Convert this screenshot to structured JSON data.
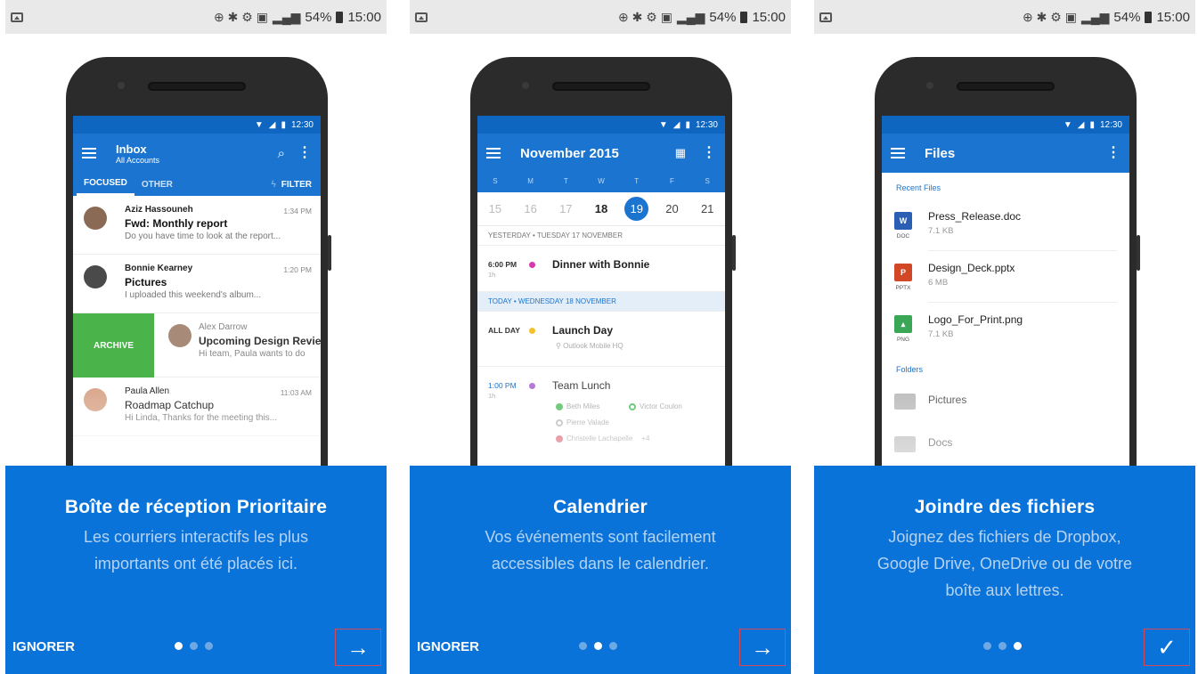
{
  "status_bar": {
    "battery": "54%",
    "time": "15:00",
    "net": "4G"
  },
  "inbox": {
    "phone_time": "12:30",
    "title": "Inbox",
    "subtitle": "All Accounts",
    "tab_focused": "FOCUSED",
    "tab_other": "OTHER",
    "filter": "FILTER",
    "mails": [
      {
        "name": "Aziz Hassouneh",
        "time": "1:34 PM",
        "subject": "Fwd: Monthly report",
        "preview": "Do you have time to look at the report..."
      },
      {
        "name": "Bonnie Kearney",
        "time": "1:20 PM",
        "subject": "Pictures",
        "preview": "I uploaded this weekend's album..."
      }
    ],
    "archive": "ARCHIVE",
    "swiped": {
      "name": "Alex Darrow",
      "subject": "Upcoming Design Revie",
      "preview": "Hi team, Paula wants to do"
    },
    "last": {
      "name": "Paula Allen",
      "time": "11:03 AM",
      "subject": "Roadmap Catchup",
      "preview": "Hi Linda, Thanks for the meeting this..."
    }
  },
  "calendar": {
    "phone_time": "12:30",
    "title": "November 2015",
    "weekdays": [
      "S",
      "M",
      "T",
      "W",
      "T",
      "F",
      "S"
    ],
    "days": [
      "15",
      "16",
      "17",
      "18",
      "19",
      "20",
      "21"
    ],
    "yesterday_header": "YESTERDAY • TUESDAY 17 NOVEMBER",
    "today_header": "TODAY • WEDNESDAY 18 NOVEMBER",
    "events": [
      {
        "time": "6:00 PM",
        "dur": "1h",
        "title": "Dinner with Bonnie",
        "color": "#d63aa9"
      },
      {
        "time": "ALL DAY",
        "dur": "",
        "title": "Launch Day",
        "location": "Outlook Mobile HQ",
        "color": "#f2c12e"
      },
      {
        "time": "1:00 PM",
        "dur": "1h",
        "title": "Team Lunch",
        "color": "#b47ad4"
      }
    ],
    "attendees": [
      "Beth Miles",
      "Victor Coulon",
      "Pierre Valade",
      "Christelle Lachapelle",
      "+4"
    ]
  },
  "files": {
    "phone_time": "12:30",
    "title": "Files",
    "recent_label": "Recent Files",
    "items": [
      {
        "name": "Press_Release.doc",
        "size": "7.1 KB",
        "type": "DOC",
        "icon": "word-icon",
        "color": "#2b5fb4"
      },
      {
        "name": "Design_Deck.pptx",
        "size": "6 MB",
        "type": "PPTX",
        "icon": "powerpoint-icon",
        "color": "#d24726"
      },
      {
        "name": "Logo_For_Print.png",
        "size": "7.1 KB",
        "type": "PNG",
        "icon": "image-icon",
        "color": "#3aa757"
      }
    ],
    "folders_label": "Folders",
    "folders": [
      "Pictures",
      "Docs"
    ]
  },
  "onboarding": [
    {
      "title": "Boîte de réception Prioritaire",
      "lines": [
        "Les courriers interactifs les plus",
        "importants ont été placés ici."
      ],
      "skip": "IGNORER",
      "next": "→"
    },
    {
      "title": "Calendrier",
      "lines": [
        "Vos événements sont facilement",
        "accessibles dans le calendrier."
      ],
      "skip": "IGNORER",
      "next": "→"
    },
    {
      "title": "Joindre des fichiers",
      "lines": [
        "Joignez des fichiers de Dropbox,",
        "Google Drive, OneDrive ou de votre",
        "boîte aux lettres."
      ],
      "skip": "",
      "next": "✓"
    }
  ],
  "colors": {
    "accent": "#0a73d9",
    "appbar": "#1b74cf",
    "archive": "#4ab44a",
    "highlight_box": "#d34a5a"
  }
}
